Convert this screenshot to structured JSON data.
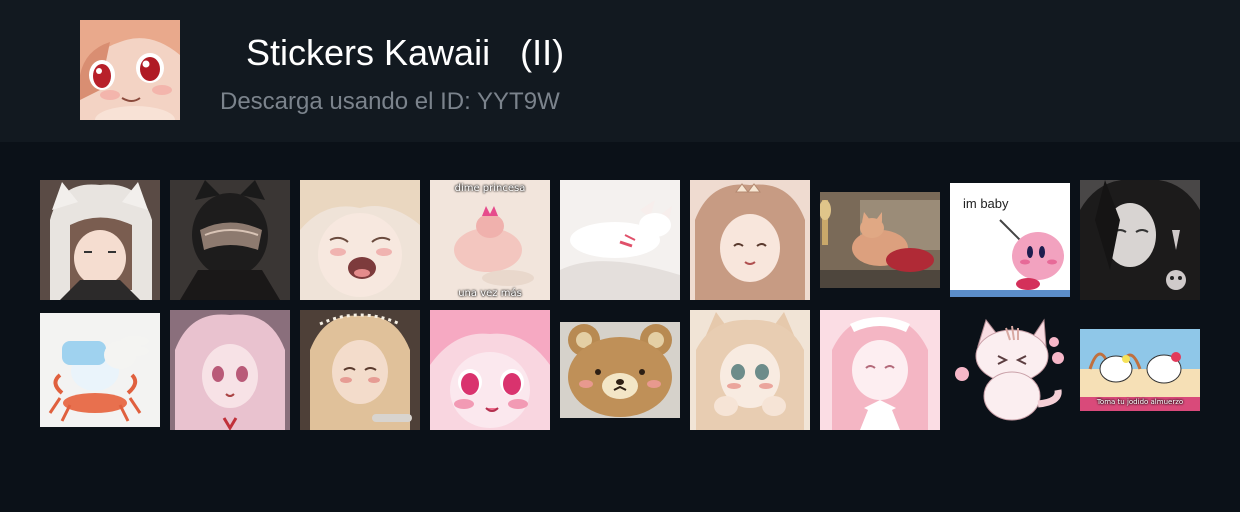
{
  "pack": {
    "title": "Stickers Kawaii   (II)",
    "subtitle": "Descarga usando el ID: YYT9W",
    "thumbnail_icon": "anime-girl-face-icon"
  },
  "colors": {
    "page_background": "#0b1118",
    "header_background": "#121920",
    "title": "#ffffff",
    "subtitle": "#7b838c"
  },
  "stickers": {
    "s3_top": "dime princesa",
    "s3_bottom": "una vez más",
    "s7_caption": "im baby",
    "s17_caption": "Toma tu jodido almuerzo"
  }
}
